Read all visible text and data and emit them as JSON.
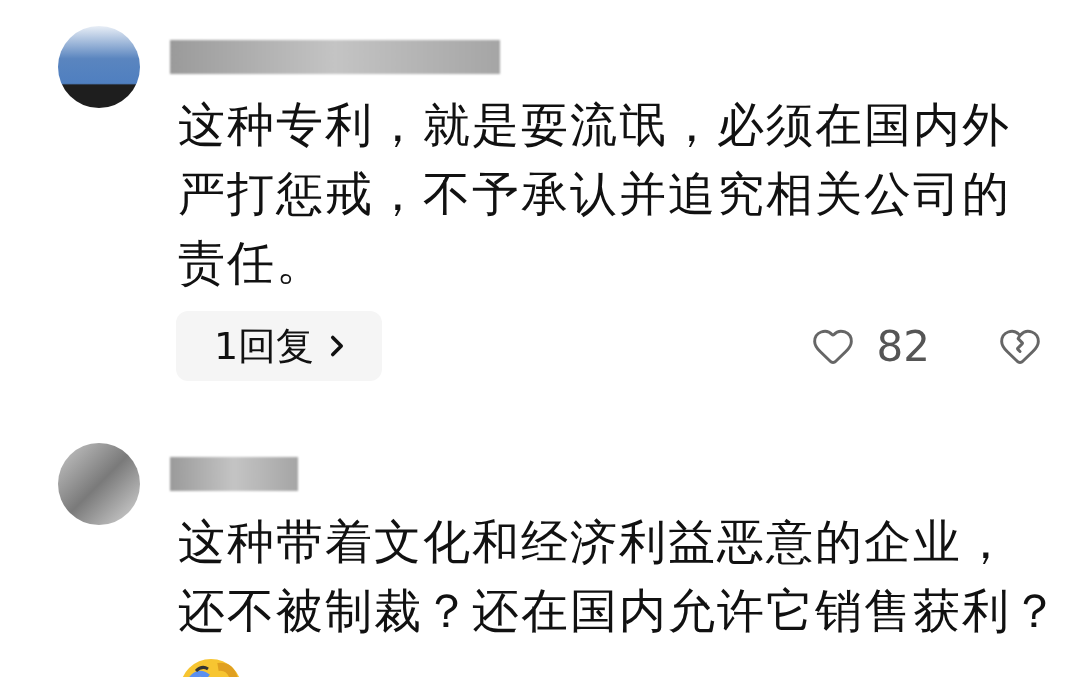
{
  "comments": [
    {
      "author_redacted": true,
      "avatar": {
        "kind": "landscape"
      },
      "text_lines": [
        "这种专利，就是耍流氓，必须在国内外",
        "严打惩戒，不予承认并追究相关公司的",
        "责任。"
      ],
      "reply_count": "1回复",
      "likes": "82"
    },
    {
      "author_redacted": true,
      "avatar": {
        "kind": "grey"
      },
      "text_lines": [
        "这种带着文化和经济利益恶意的企业，",
        "还不被制裁？还在国内允许它销售获利？"
      ],
      "emoji": true
    }
  ]
}
